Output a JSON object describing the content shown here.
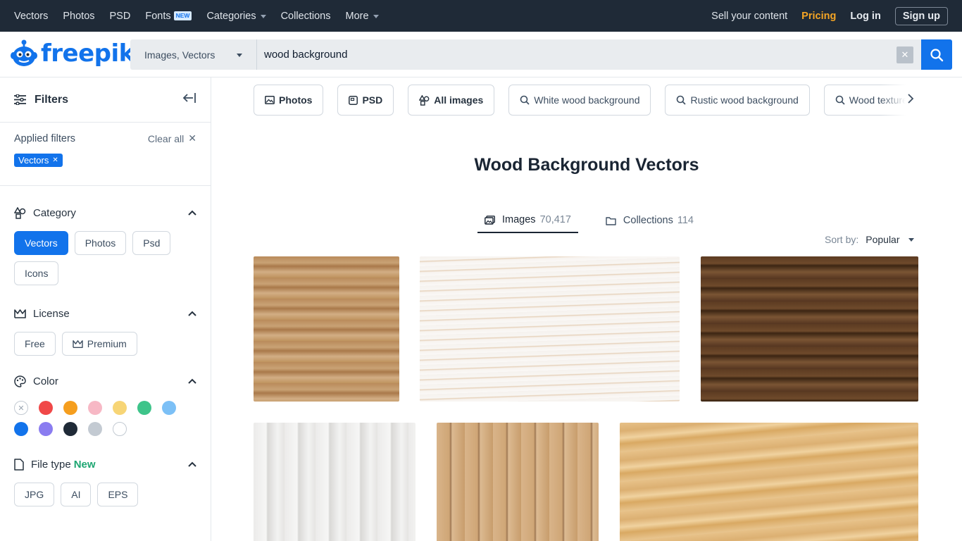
{
  "topbar": {
    "nav": [
      "Vectors",
      "Photos",
      "PSD",
      "Fonts",
      "Categories",
      "Collections",
      "More"
    ],
    "new_badge": "NEW",
    "sell": "Sell your content",
    "pricing": "Pricing",
    "login": "Log in",
    "signup": "Sign up"
  },
  "brand": {
    "name": "freepik",
    "color": "#1273eb"
  },
  "search": {
    "type": "Images, Vectors",
    "query": "wood background",
    "clear_icon": "close-icon",
    "button_icon": "search-icon"
  },
  "sidebar": {
    "title": "Filters",
    "applied_label": "Applied filters",
    "clear_all": "Clear all",
    "applied_chip": "Vectors",
    "category": {
      "title": "Category",
      "options": [
        "Vectors",
        "Photos",
        "Psd",
        "Icons"
      ],
      "selected": "Vectors"
    },
    "license": {
      "title": "License",
      "options": [
        "Free",
        "Premium"
      ]
    },
    "color": {
      "title": "Color",
      "swatches": [
        "#ffffff",
        "#f04848",
        "#f59e1e",
        "#f7b8c5",
        "#f7d576",
        "#3ec48a",
        "#7cc0f6",
        "#1273eb",
        "#8a7cf0",
        "#1f2a37",
        "#c3cad2",
        "#ffffff"
      ]
    },
    "filetype": {
      "title": "File type",
      "new": "New",
      "options": [
        "JPG",
        "AI",
        "EPS"
      ]
    }
  },
  "main": {
    "tags": [
      {
        "label": "Photos",
        "bold": true
      },
      {
        "label": "PSD",
        "bold": true
      },
      {
        "label": "All images",
        "bold": true
      },
      {
        "label": "White wood background",
        "bold": false
      },
      {
        "label": "Rustic wood background",
        "bold": false
      },
      {
        "label": "Wood texture",
        "bold": false
      }
    ],
    "title": "Wood Background Vectors",
    "tabs": [
      {
        "label": "Images",
        "count": "70,417"
      },
      {
        "label": "Collections",
        "count": "114"
      }
    ],
    "sort_label": "Sort by:",
    "sort_value": "Popular"
  }
}
